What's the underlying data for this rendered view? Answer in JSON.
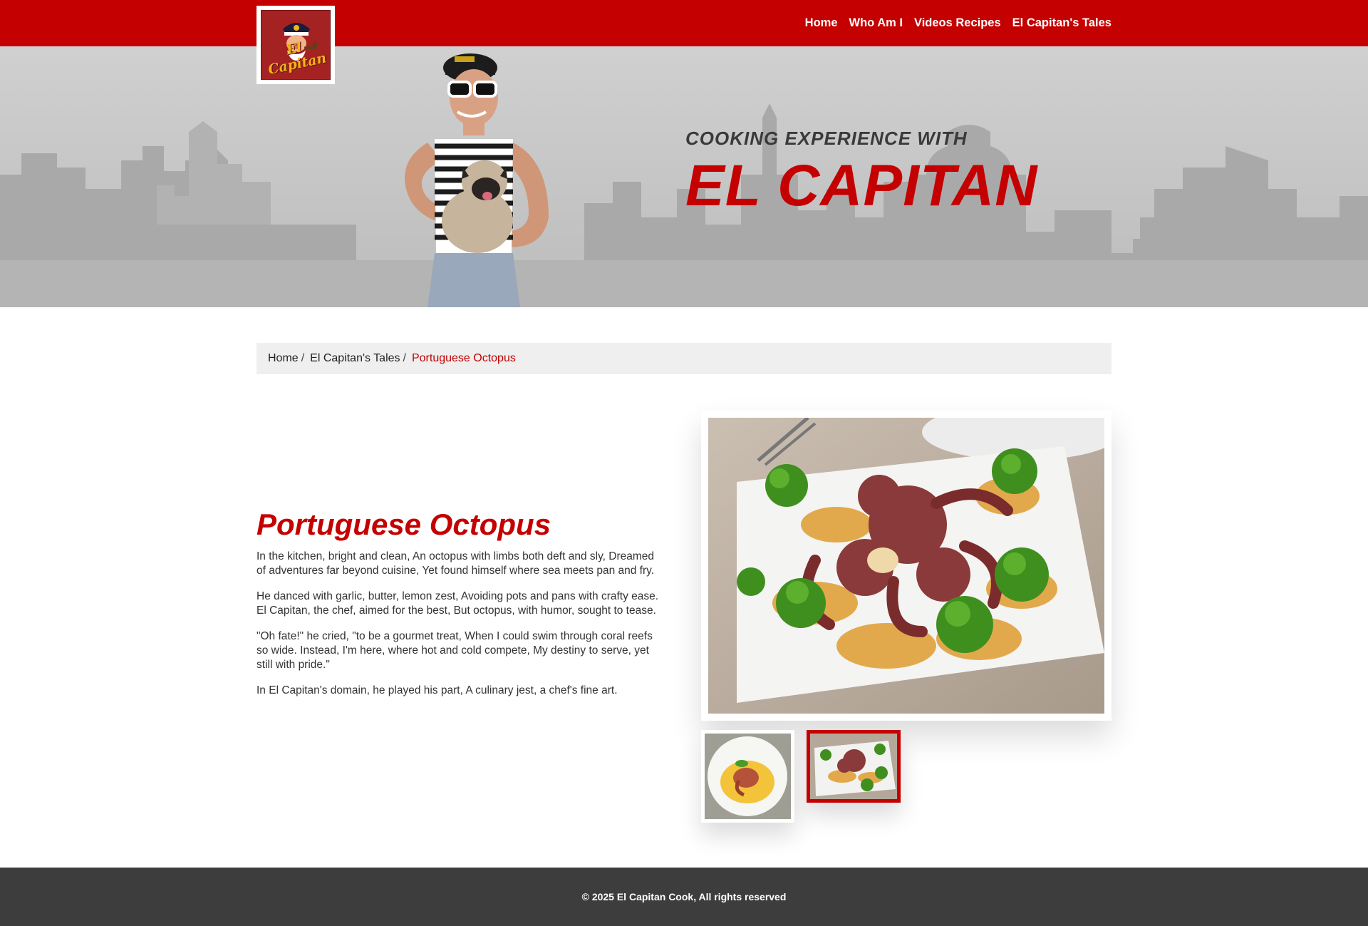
{
  "header": {
    "logo_text": "El Capitan",
    "nav": [
      {
        "label": "Home"
      },
      {
        "label": "Who Am I"
      },
      {
        "label": "Videos Recipes"
      },
      {
        "label": "El Capitan's Tales"
      }
    ]
  },
  "hero": {
    "subtitle": "COOKING EXPERIENCE WITH",
    "title": "EL CAPITAN"
  },
  "breadcrumb": {
    "items": [
      "Home",
      "El Capitan's Tales"
    ],
    "current": "Portuguese Octopus"
  },
  "article": {
    "title": "Portuguese Octopus",
    "paragraphs": [
      "In the kitchen, bright and clean, An octopus with limbs both deft and sly, Dreamed of adventures far beyond cuisine, Yet found himself where sea meets pan and fry.",
      "He danced with garlic, butter, lemon zest, Avoiding pots and pans with crafty ease. El Capitan, the chef, aimed for the best, But octopus, with humor, sought to tease.",
      "\"Oh fate!\" he cried, \"to be a gourmet treat, When I could swim through coral reefs so wide. Instead, I'm here, where hot and cold compete, My destiny to serve, yet still with pride.\"",
      "In El Capitan's domain, he played his part, A culinary jest, a chef's fine art."
    ]
  },
  "gallery": {
    "selected_index": 1,
    "thumb_count": 2
  },
  "footer": {
    "copyright": "© 2025 El Capitan Cook, All rights reserved"
  },
  "colors": {
    "brand_red": "#c40000",
    "footer_bg": "#3d3d3d",
    "breadcrumb_bg": "#efefef"
  }
}
